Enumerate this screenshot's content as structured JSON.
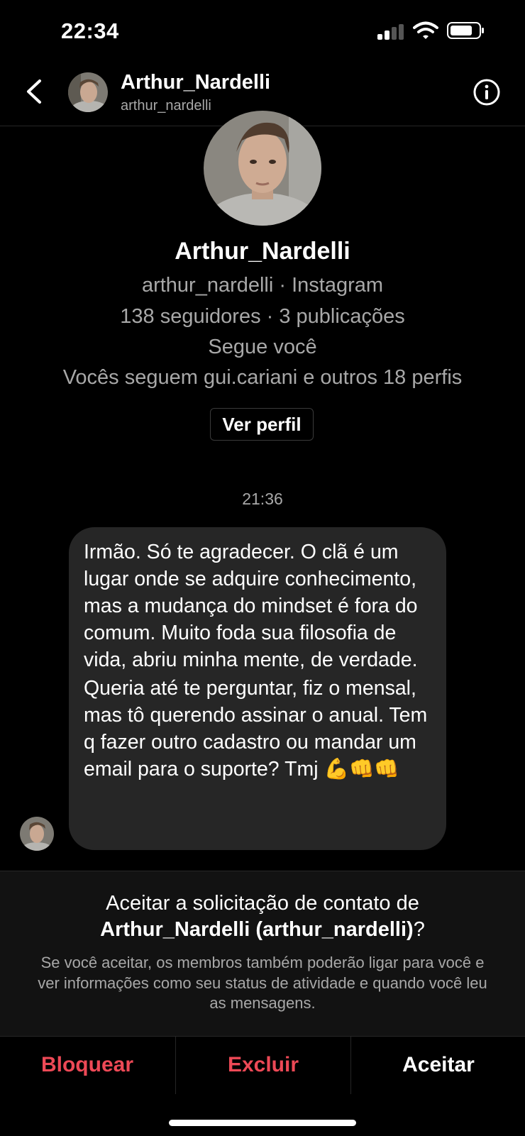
{
  "status_bar": {
    "time": "22:34",
    "icons": [
      "signal-icon",
      "wifi-icon",
      "battery-icon"
    ]
  },
  "header": {
    "display_name": "Arthur_Nardelli",
    "username": "arthur_nardelli",
    "icons": [
      "back-arrow-icon",
      "info-icon"
    ]
  },
  "profile": {
    "name": "Arthur_Nardelli",
    "user_line": "arthur_nardelli · Instagram",
    "stats_line": "138 seguidores · 3 publicações",
    "follows_line": "Segue você",
    "mutual_line": "Vocês seguem gui.cariani e outros 18 perfis",
    "view_profile_label": "Ver perfil"
  },
  "conversation": {
    "timestamp": "21:36",
    "message_paragraph_1": "Irmão. Só te agradecer. O clã é um lugar onde se adquire conhecimento, mas a mudança do mindset é fora do comum. Muito foda sua filosofia de vida, abriu minha mente, de verdade.",
    "message_paragraph_2": "Queria até te perguntar, fiz o mensal, mas tô querendo assinar o anual. Tem q fazer outro cadastro ou mandar um email para o suporte? Tmj 💪👊👊"
  },
  "request": {
    "title_prefix": "Aceitar a solicitação de contato de",
    "title_name": "Arthur_Nardelli (arthur_nardelli)",
    "title_suffix": "?",
    "description": "Se você aceitar, os membros também poderão ligar para você e ver informações como seu status de atividade e quando você leu as mensagens."
  },
  "actions": {
    "block_label": "Bloquear",
    "delete_label": "Excluir",
    "accept_label": "Aceitar"
  },
  "colors": {
    "background": "#000000",
    "bubble": "#262626",
    "danger": "#ed4956",
    "secondary_text": "#a8a8a8"
  }
}
